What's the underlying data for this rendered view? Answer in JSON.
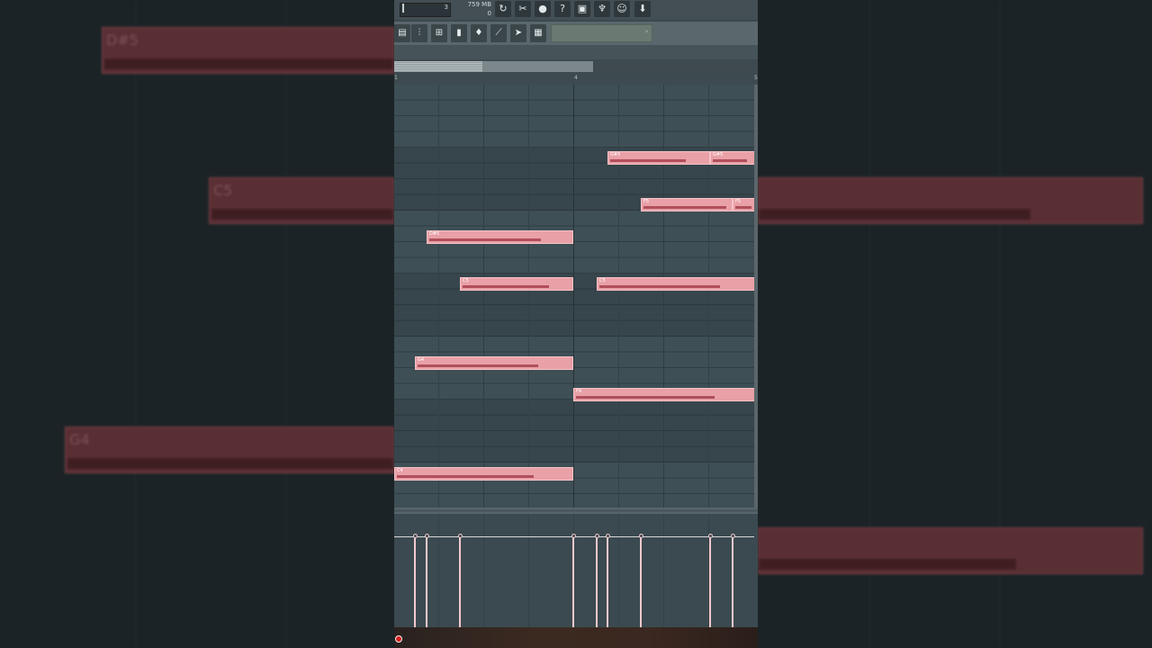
{
  "toolbar": {
    "slider_value": "3",
    "memory": "759 MB",
    "cpu": "0",
    "buttons": [
      {
        "name": "undo-icon",
        "glyph": "↻"
      },
      {
        "name": "cut-icon",
        "glyph": "✂"
      },
      {
        "name": "mic-icon",
        "glyph": "🎤"
      },
      {
        "name": "help-icon",
        "glyph": "?"
      },
      {
        "name": "save-icon",
        "glyph": "▣"
      },
      {
        "name": "mixer-icon",
        "glyph": "♆"
      },
      {
        "name": "chat-icon",
        "glyph": "☺"
      },
      {
        "name": "download-icon",
        "glyph": "⬇"
      }
    ],
    "tools": [
      {
        "name": "piano-roll-icon",
        "glyph": "▤"
      },
      {
        "name": "mixer-fader-icon",
        "glyph": "⫶"
      },
      {
        "name": "channel-rack-icon",
        "glyph": "⊞"
      },
      {
        "name": "browser-icon",
        "glyph": "▮"
      },
      {
        "name": "plugin-icon",
        "glyph": "♦"
      },
      {
        "name": "step-icon",
        "glyph": "⟋"
      },
      {
        "name": "pattern-icon",
        "glyph": "➤"
      },
      {
        "name": "playlist-icon",
        "glyph": "▦"
      }
    ],
    "field_arrow": "›"
  },
  "ruler": {
    "marks": [
      "1",
      "4",
      "5"
    ]
  },
  "notes": [
    {
      "label": "G#5",
      "row": 5
    },
    {
      "label": "G#5",
      "row": 5
    },
    {
      "label": "F5",
      "row": 8
    },
    {
      "label": "F5",
      "row": 8
    },
    {
      "label": "D#5",
      "row": 10
    },
    {
      "label": "C5",
      "row": 13
    },
    {
      "label": "C5",
      "row": 13
    },
    {
      "label": "G4",
      "row": 18
    },
    {
      "label": "F4",
      "row": 20
    },
    {
      "label": "C4",
      "row": 25
    }
  ],
  "background_notes": [
    "D#5",
    "C5",
    "G4"
  ],
  "accent_color": "#e9a0a7"
}
